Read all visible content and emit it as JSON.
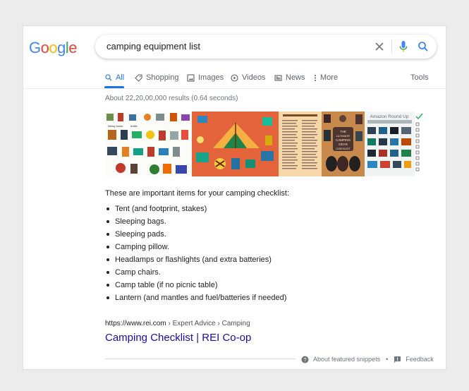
{
  "logo": {
    "letters": [
      "G",
      "o",
      "o",
      "g",
      "l",
      "e"
    ],
    "colors": [
      "#4285f4",
      "#ea4335",
      "#fbbc05",
      "#4285f4",
      "#34a853",
      "#ea4335"
    ]
  },
  "search": {
    "query": "camping equipment list"
  },
  "tabs": [
    {
      "label": "All",
      "icon": "search-icon",
      "active": true
    },
    {
      "label": "Shopping",
      "icon": "tag-icon"
    },
    {
      "label": "Images",
      "icon": "image-icon"
    },
    {
      "label": "Videos",
      "icon": "video-icon"
    },
    {
      "label": "News",
      "icon": "news-icon"
    },
    {
      "label": "More",
      "icon": "more-vert-icon"
    },
    {
      "label": "Tools"
    }
  ],
  "results_stats": "About 22,20,00,000 results (0.64 seconds)",
  "thumbnails": [
    {
      "alt": "camping items illustration grid"
    },
    {
      "alt": "camping gear around tent illustration"
    },
    {
      "alt": "camping checklist printable"
    },
    {
      "alt": "The Ultimate Camping Gear Checklist"
    },
    {
      "alt": "Amazon Round Up camping items"
    },
    {
      "alt": "camping checklist"
    }
  ],
  "snippet": {
    "intro": "These are important items for your camping checklist:",
    "items": [
      "Tent (and footprint, stakes)",
      "Sleeping bags.",
      "Sleeping pads.",
      "Camping pillow.",
      "Headlamps or flashlights (and extra batteries)",
      "Camp chairs.",
      "Camp table (if no picnic table)",
      "Lantern (and mantles and fuel/batteries if needed)"
    ]
  },
  "result": {
    "url": "https://www.rei.com",
    "breadcrumb": " › Expert Advice › Camping",
    "title": "Camping Checklist | REI Co-op"
  },
  "footer": {
    "about": "About featured snippets",
    "separator": "•",
    "feedback": "Feedback"
  },
  "colors": {
    "accent": "#1a73e8",
    "link": "#1a0dab"
  }
}
